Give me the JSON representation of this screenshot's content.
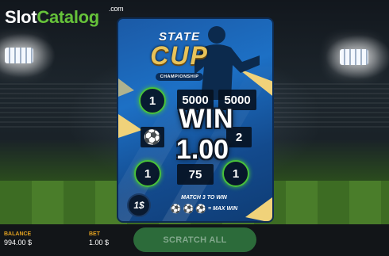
{
  "logo": {
    "brand_a": "Slot",
    "brand_b": "Catalog",
    "suffix": ".com"
  },
  "card": {
    "title_line1": "STATE",
    "title_line2": "CUP",
    "title_sub": "CHAMPIONSHIP",
    "grid": {
      "row1": [
        "1",
        "5000",
        "5000"
      ],
      "row2_right": "2",
      "row3": [
        "1",
        "75",
        "1"
      ]
    },
    "win_label": "WIN",
    "win_amount": "1.00",
    "price": "1$",
    "rules_line1": "MATCH 3 TO WIN",
    "rules_line2": "= MAX WIN"
  },
  "footer": {
    "balance_label": "BALANCE",
    "balance_value": "994.00 $",
    "bet_label": "BET",
    "bet_value": "1.00 $",
    "scratch_button": "SCRATCH ALL"
  },
  "colors": {
    "accent_gold": "#e8c35a",
    "winning_ring": "#49c23a",
    "label_orange": "#e0a020",
    "button_green": "#2c6b3a"
  },
  "icons": [
    "soccer-ball-icon",
    "player-silhouette"
  ]
}
